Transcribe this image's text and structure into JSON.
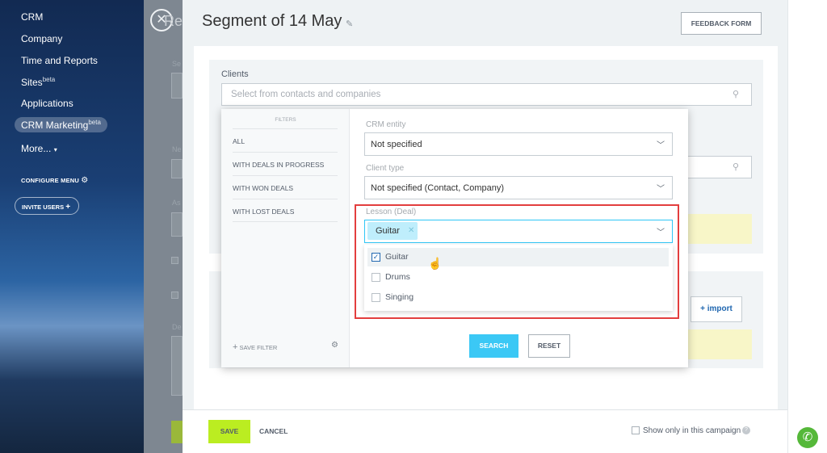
{
  "sidebar": {
    "items": [
      {
        "label": "CRM"
      },
      {
        "label": "Company"
      },
      {
        "label": "Time and Reports"
      },
      {
        "label": "Sites",
        "badge": "beta"
      },
      {
        "label": "Applications"
      },
      {
        "label": "CRM Marketing",
        "badge": "beta"
      },
      {
        "label": "More..."
      }
    ],
    "configure_menu": "CONFIGURE MENU",
    "invite_users": "INVITE USERS"
  },
  "background_page": {
    "title_fragment": "Re",
    "ghost_labels": [
      "Se",
      "Ne",
      "As",
      "De"
    ]
  },
  "header": {
    "title": "Segment of 14 May",
    "feedback_button": "FEEDBACK FORM"
  },
  "clients": {
    "label": "Clients",
    "placeholder": "Select from contacts and companies"
  },
  "filters_panel": {
    "header": "FILTERS",
    "presets": [
      "ALL",
      "WITH DEALS IN PROGRESS",
      "WITH WON DEALS",
      "WITH LOST DEALS"
    ],
    "save_filter": "SAVE FILTER",
    "fields": {
      "crm_entity": {
        "label": "CRM entity",
        "value": "Not specified"
      },
      "client_type": {
        "label": "Client type",
        "value": "Not specified (Contact, Company)"
      },
      "lesson": {
        "label": "Lesson (Deal)",
        "selected_tag": "Guitar",
        "options": [
          {
            "label": "Guitar",
            "checked": true
          },
          {
            "label": "Drums",
            "checked": false
          },
          {
            "label": "Singing",
            "checked": false
          }
        ]
      }
    },
    "search_button": "SEARCH",
    "reset_button": "RESET"
  },
  "import_button": "+ import",
  "footer": {
    "save": "SAVE",
    "cancel": "CANCEL",
    "show_only": "Show only in this campaign"
  },
  "colors": {
    "accent_blue": "#3bc8f5",
    "save_green": "#bbed21",
    "highlight_red": "#e33e3e",
    "phone_green": "#55b839"
  }
}
